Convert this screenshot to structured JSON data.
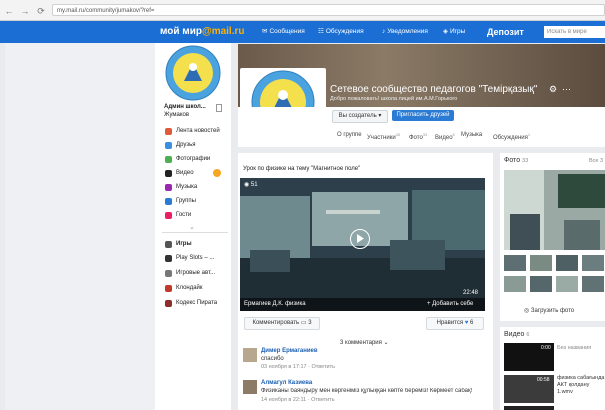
{
  "browser": {
    "url": "my.mail.ru/community/jumakov/?ref="
  },
  "topbar": {
    "logo_main": "мой мир",
    "logo_domain": "@mail.ru",
    "nav": [
      {
        "label": "Сообщения",
        "icon": "chat-icon"
      },
      {
        "label": "Обсуждения",
        "icon": "discussion-icon"
      },
      {
        "label": "Уведомления",
        "icon": "bell-icon"
      },
      {
        "label": "Игры",
        "icon": "gamepad-icon"
      }
    ],
    "deposit": "Депозит",
    "search_placeholder": "Искать в мире"
  },
  "sidebar": {
    "admin_name": "Админ школ...",
    "admin_sub": "Жумаков",
    "items": [
      {
        "label": "Лента новостей",
        "icon": "news-icon",
        "color": "#e05a3a"
      },
      {
        "label": "Друзья",
        "icon": "friends-icon",
        "color": "#3a8ee0"
      },
      {
        "label": "Фотографии",
        "icon": "photo-icon",
        "color": "#4caf50"
      },
      {
        "label": "Видео",
        "icon": "video-icon",
        "color": "#222222"
      },
      {
        "label": "Музыка",
        "icon": "music-icon",
        "color": "#9c27b0"
      },
      {
        "label": "Группы",
        "icon": "groups-icon",
        "color": "#2a7bd4"
      },
      {
        "label": "Гости",
        "icon": "guests-icon",
        "color": "#e91e63"
      }
    ],
    "games_title": "Игры",
    "games": [
      {
        "label": "Play Slots – ...",
        "icon": "slots-icon",
        "color": "#333333"
      },
      {
        "label": "Игровые авт...",
        "icon": "slot-machine-icon",
        "color": "#777777"
      },
      {
        "label": "Клондайк",
        "icon": "cards-icon",
        "color": "#c0392b"
      },
      {
        "label": "Кодекс Пирата",
        "icon": "pirate-icon",
        "color": "#8e2c2c"
      }
    ]
  },
  "group": {
    "title": "Сетевое сообщество педагогов \"Темірқазық\"",
    "subtitle": "Добро пожаловать! школа лицей им.А.М.Горького",
    "my_status_button": "Вы создатель",
    "invite_button": "Пригласить друзей",
    "tabs": [
      {
        "label": "О группе",
        "count": ""
      },
      {
        "label": "Участники",
        "count": "45"
      },
      {
        "label": "Фото",
        "count": "33"
      },
      {
        "label": "Видео",
        "count": "6"
      },
      {
        "label": "Музыка",
        "count": ""
      },
      {
        "label": "Обсуждения",
        "count": "1"
      }
    ]
  },
  "post": {
    "caption": "Урок по физике на тему \"Магнитное поле\"",
    "views": "51",
    "duration": "22:48",
    "author_tag": "Ермагиев Д.К. физика",
    "add_label": "Добавить себе",
    "comment_button": "Комментировать",
    "comment_count": "3",
    "like_button": "Нравится",
    "like_count": "6",
    "comments_toggle": "3 комментария",
    "comments": [
      {
        "name": "Димер Ермаганиев",
        "text": "спасибо",
        "date": "03 ноября в 17:17",
        "reply": "Ответить"
      },
      {
        "name": "Алмагул Казиева",
        "text": "Физиканы баяндыру мен көргеніміз құлыққан көпте береміз!  Көрмеет сабақ!",
        "date": "14 ноября в 22:11",
        "reply": "Ответить"
      }
    ]
  },
  "photos": {
    "title": "Фото",
    "count": "33",
    "all_label": "Все 3",
    "upload": "Загрузить фото"
  },
  "videos": {
    "title": "Видео",
    "count": "6",
    "items": [
      {
        "duration": "0:00",
        "title": "Без названия"
      },
      {
        "duration": "00:58",
        "title": "физика сабағында АКТ қолдану 1.wmv"
      },
      {
        "duration": "0:00",
        "title": ""
      }
    ]
  }
}
